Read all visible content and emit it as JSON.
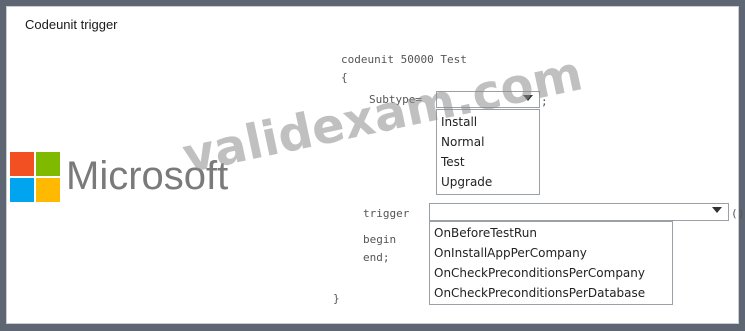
{
  "panel": {
    "title": "Codeunit trigger"
  },
  "code": {
    "header": "codeunit 50000 Test",
    "open_brace": "{",
    "subtype_label": "Subtype=",
    "subtype_terminator": ";",
    "trigger_label": "trigger",
    "trigger_suffix": "()",
    "begin": "begin",
    "end": "end;",
    "close_brace": "}"
  },
  "subtype_dropdown": {
    "selected": "",
    "options": [
      "Install",
      "Normal",
      "Test",
      "Upgrade"
    ]
  },
  "trigger_dropdown": {
    "selected": "",
    "options": [
      "OnBeforeTestRun",
      "OnInstallAppPerCompany",
      "OnCheckPreconditionsPerCompany",
      "OnCheckPreconditionsPerDatabase"
    ]
  },
  "logo": {
    "text": "Microsoft",
    "colors": [
      "#f25022",
      "#7fba00",
      "#00a4ef",
      "#ffb900"
    ]
  },
  "watermark": {
    "text": "validexam.com"
  }
}
